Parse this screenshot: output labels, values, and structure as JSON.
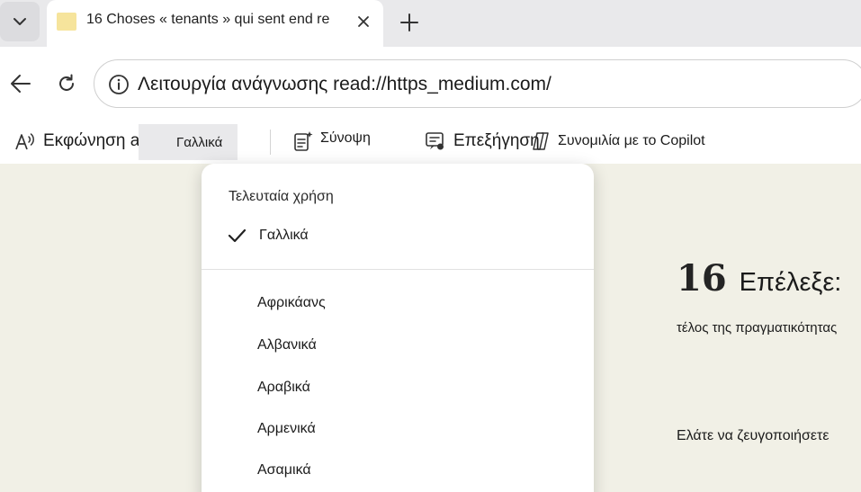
{
  "browser": {
    "tab": {
      "title": "16 Choses « tenants » qui sent end re"
    },
    "address": {
      "url": "Λειτουργία ανάγνωσης read://https_medium.com/"
    }
  },
  "reader_toolbar": {
    "read_aloud_label": "Εκφώνηση ab",
    "language_label": "Γαλλικά",
    "summary_label": "Σύνοψη",
    "explain_label": "Επεξήγηση",
    "copilot_label": "Συνομιλία με το Copilot"
  },
  "language_menu": {
    "section_label": "Τελευταία χρήση",
    "selected": "Γαλλικά",
    "items": [
      "Αφρικάανς",
      "Αλβανικά",
      "Αραβικά",
      "Αρμενικά",
      "Ασαμικά"
    ]
  },
  "article": {
    "number": "16",
    "heading": "Επέλεξε:",
    "line1": "τέλος της πραγματικότητας",
    "line2": "Ελάτε να ζευγοποιήσετε"
  },
  "colors": {
    "page_background": "#f1f0e6",
    "tabstrip": "#e9e9eb",
    "favicon": "#f6e49c"
  }
}
